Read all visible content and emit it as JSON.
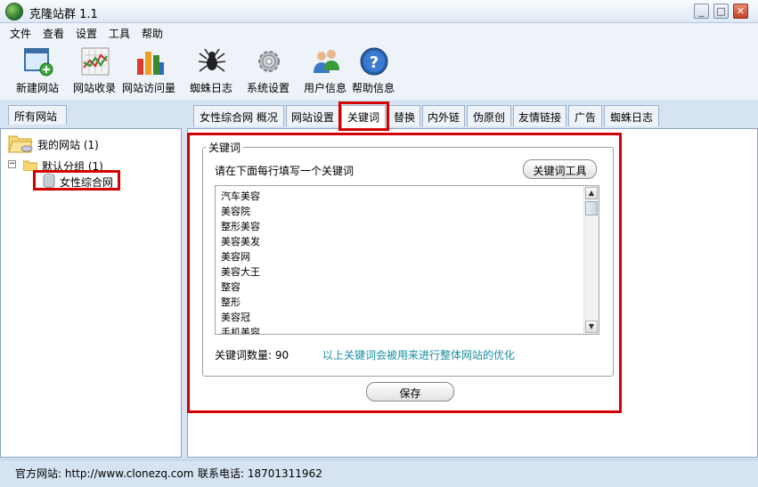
{
  "window": {
    "title": "克隆站群 1.1",
    "minimize": "_",
    "maximize": "□",
    "close": "✕"
  },
  "menu": [
    "文件",
    "查看",
    "设置",
    "工具",
    "帮助"
  ],
  "toolbar": [
    {
      "label": "新建网站",
      "icon": "new-site-icon"
    },
    {
      "label": "网站收录",
      "icon": "index-chart-icon"
    },
    {
      "label": "网站访问量",
      "icon": "bar-chart-icon"
    },
    {
      "label": "蜘蛛日志",
      "icon": "spider-icon"
    },
    {
      "label": "系统设置",
      "icon": "gear-icon"
    },
    {
      "label": "用户信息",
      "icon": "users-icon"
    },
    {
      "label": "帮助信息",
      "icon": "help-icon"
    }
  ],
  "sidebar": {
    "tab": "所有网站",
    "root": "我的网站 (1)",
    "group": "默认分组 (1)",
    "site": "女性综合网"
  },
  "tabs": [
    "女性综合网 概况",
    "网站设置",
    "关键词",
    "替换",
    "内外链",
    "伪原创",
    "友情链接",
    "广告",
    "蜘蛛日志"
  ],
  "active_tab": "关键词",
  "keywords_panel": {
    "group_title": "关键词",
    "prompt": "请在下面每行填写一个关键词",
    "tool_button": "关键词工具",
    "keywords": [
      "汽车美容",
      "美容院",
      "整形美容",
      "美容美发",
      "美容网",
      "美容大王",
      "整容",
      "整形",
      "美容冠",
      "手机美容"
    ],
    "count_label": "关键词数量:",
    "count": "90",
    "hint": "以上关键词会被用来进行整体网站的优化",
    "save_button": "保存"
  },
  "status": {
    "website": "官方网站: http://www.clonezq.com",
    "phone": "联系电话: 18701311962"
  }
}
